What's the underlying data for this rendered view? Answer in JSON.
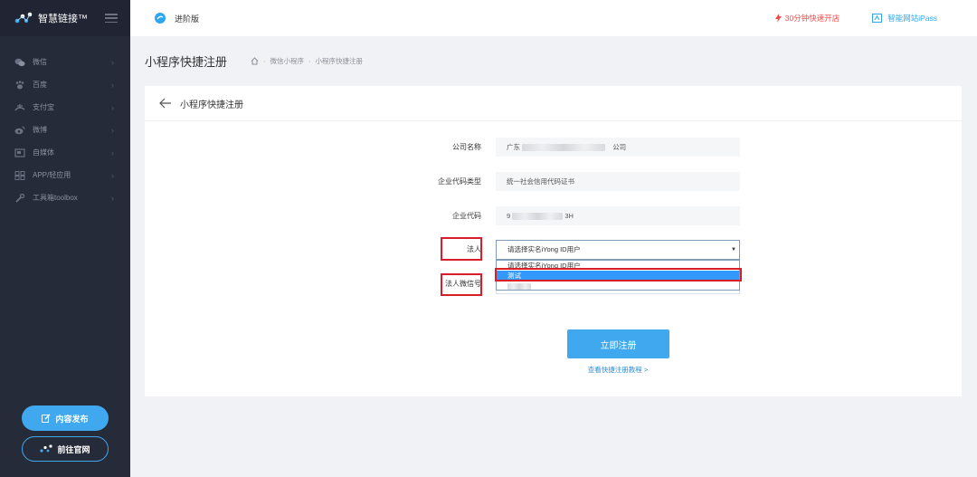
{
  "brand": {
    "name": "智慧链接™"
  },
  "sidebar": {
    "items": [
      {
        "label": "微信",
        "icon": "wechat-icon"
      },
      {
        "label": "百度",
        "icon": "baidu-paw-icon"
      },
      {
        "label": "支付宝",
        "icon": "alipay-icon"
      },
      {
        "label": "微博",
        "icon": "weibo-icon"
      },
      {
        "label": "自媒体",
        "icon": "media-icon"
      },
      {
        "label": "APP/轻应用",
        "icon": "app-grid-icon"
      },
      {
        "label": "工具箱toolbox",
        "icon": "wrench-icon"
      }
    ],
    "publish_label": "内容发布",
    "site_label": "前往官网"
  },
  "topbar": {
    "edition": "进阶版",
    "quick_open": "30分钟快速开店",
    "ipass": "智能网站iPass"
  },
  "page": {
    "title": "小程序快捷注册",
    "breadcrumb": [
      "微信小程序",
      "小程序快捷注册"
    ]
  },
  "card": {
    "title": "小程序快捷注册"
  },
  "form": {
    "company_name_label": "公司名称",
    "company_name_prefix": "广东",
    "company_name_suffix": "公司",
    "code_type_label": "企业代码类型",
    "code_type_value": "统一社会信用代码证书",
    "code_label": "企业代码",
    "code_prefix": "9",
    "code_suffix": "3H",
    "legal_label": "法人",
    "legal_selected": "请选择实名iYong ID用户",
    "legal_options": [
      "请选择实名iYong ID用户",
      "测试"
    ],
    "legal_wechat_label": "法人微信号",
    "submit_label": "立即注册",
    "tutorial_link": "查看快捷注册教程 >"
  },
  "colors": {
    "sidebar_bg": "#262b3a",
    "accent": "#3fa8ee",
    "highlight": "#d81e28",
    "quick_open": "#ef4b4b"
  }
}
